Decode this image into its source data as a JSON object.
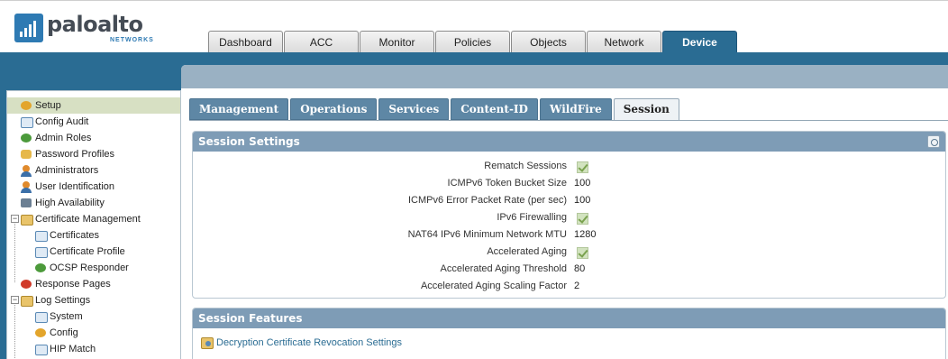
{
  "brand": {
    "name": "paloalto",
    "sub": "NETWORKS"
  },
  "main_tabs": [
    {
      "label": "Dashboard"
    },
    {
      "label": "ACC"
    },
    {
      "label": "Monitor"
    },
    {
      "label": "Policies"
    },
    {
      "label": "Objects"
    },
    {
      "label": "Network"
    },
    {
      "label": "Device",
      "active": true
    }
  ],
  "sidebar": {
    "items": [
      {
        "label": "Setup",
        "icon": "setup-icon",
        "selected": true
      },
      {
        "label": "Config Audit",
        "icon": "config-audit-icon"
      },
      {
        "label": "Admin Roles",
        "icon": "admin-roles-icon"
      },
      {
        "label": "Password Profiles",
        "icon": "password-profiles-icon"
      },
      {
        "label": "Administrators",
        "icon": "administrators-icon"
      },
      {
        "label": "User Identification",
        "icon": "user-identification-icon"
      },
      {
        "label": "High Availability",
        "icon": "high-availability-icon"
      },
      {
        "label": "Certificate Management",
        "icon": "certificate-management-icon",
        "expanded": true
      },
      {
        "label": "Certificates",
        "icon": "certificates-icon"
      },
      {
        "label": "Certificate Profile",
        "icon": "certificate-profile-icon"
      },
      {
        "label": "OCSP Responder",
        "icon": "ocsp-responder-icon"
      },
      {
        "label": "Response Pages",
        "icon": "response-pages-icon"
      },
      {
        "label": "Log Settings",
        "icon": "log-settings-icon",
        "expanded": true
      },
      {
        "label": "System",
        "icon": "system-icon"
      },
      {
        "label": "Config",
        "icon": "config-icon"
      },
      {
        "label": "HIP Match",
        "icon": "hip-match-icon"
      }
    ]
  },
  "sub_tabs": [
    {
      "label": "Management"
    },
    {
      "label": "Operations"
    },
    {
      "label": "Services"
    },
    {
      "label": "Content-ID"
    },
    {
      "label": "WildFire"
    },
    {
      "label": "Session",
      "active": true
    }
  ],
  "session_settings": {
    "title": "Session Settings",
    "rows": [
      {
        "label": "Rematch Sessions",
        "type": "checkbox",
        "checked": true
      },
      {
        "label": "ICMPv6 Token Bucket Size",
        "type": "value",
        "value": "100"
      },
      {
        "label": "ICMPv6 Error Packet Rate (per sec)",
        "type": "value",
        "value": "100"
      },
      {
        "label": "IPv6 Firewalling",
        "type": "checkbox",
        "checked": true
      },
      {
        "label": "NAT64 IPv6 Minimum Network MTU",
        "type": "value",
        "value": "1280"
      },
      {
        "label": "Accelerated Aging",
        "type": "checkbox",
        "checked": true
      },
      {
        "label": "Accelerated Aging Threshold",
        "type": "value",
        "value": "80"
      },
      {
        "label": "Accelerated Aging Scaling Factor",
        "type": "value",
        "value": "2"
      }
    ]
  },
  "session_features": {
    "title": "Session Features",
    "link": "Decryption Certificate Revocation Settings"
  },
  "colors": {
    "brand_blue": "#2a6c93",
    "panel_header": "#7e9cb6",
    "selected_row": "#d7e0c3",
    "checkbox_fill": "#d2e3bf"
  }
}
